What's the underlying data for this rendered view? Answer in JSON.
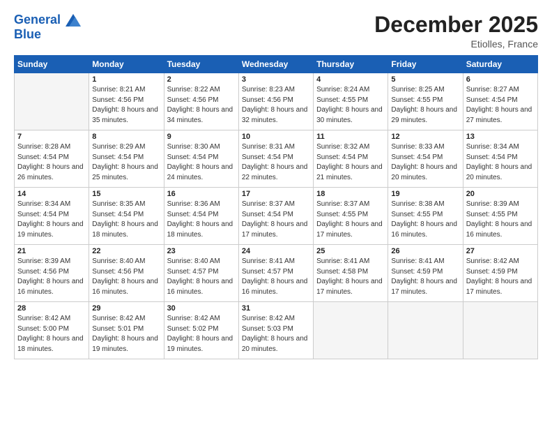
{
  "logo": {
    "line1": "General",
    "line2": "Blue"
  },
  "title": "December 2025",
  "location": "Etiolles, France",
  "days_of_week": [
    "Sunday",
    "Monday",
    "Tuesday",
    "Wednesday",
    "Thursday",
    "Friday",
    "Saturday"
  ],
  "weeks": [
    [
      {
        "num": "",
        "empty": true
      },
      {
        "num": "1",
        "sunrise": "8:21 AM",
        "sunset": "4:56 PM",
        "daylight": "8 hours and 35 minutes."
      },
      {
        "num": "2",
        "sunrise": "8:22 AM",
        "sunset": "4:56 PM",
        "daylight": "8 hours and 34 minutes."
      },
      {
        "num": "3",
        "sunrise": "8:23 AM",
        "sunset": "4:56 PM",
        "daylight": "8 hours and 32 minutes."
      },
      {
        "num": "4",
        "sunrise": "8:24 AM",
        "sunset": "4:55 PM",
        "daylight": "8 hours and 30 minutes."
      },
      {
        "num": "5",
        "sunrise": "8:25 AM",
        "sunset": "4:55 PM",
        "daylight": "8 hours and 29 minutes."
      },
      {
        "num": "6",
        "sunrise": "8:27 AM",
        "sunset": "4:54 PM",
        "daylight": "8 hours and 27 minutes."
      }
    ],
    [
      {
        "num": "7",
        "sunrise": "8:28 AM",
        "sunset": "4:54 PM",
        "daylight": "8 hours and 26 minutes."
      },
      {
        "num": "8",
        "sunrise": "8:29 AM",
        "sunset": "4:54 PM",
        "daylight": "8 hours and 25 minutes."
      },
      {
        "num": "9",
        "sunrise": "8:30 AM",
        "sunset": "4:54 PM",
        "daylight": "8 hours and 24 minutes."
      },
      {
        "num": "10",
        "sunrise": "8:31 AM",
        "sunset": "4:54 PM",
        "daylight": "8 hours and 22 minutes."
      },
      {
        "num": "11",
        "sunrise": "8:32 AM",
        "sunset": "4:54 PM",
        "daylight": "8 hours and 21 minutes."
      },
      {
        "num": "12",
        "sunrise": "8:33 AM",
        "sunset": "4:54 PM",
        "daylight": "8 hours and 20 minutes."
      },
      {
        "num": "13",
        "sunrise": "8:34 AM",
        "sunset": "4:54 PM",
        "daylight": "8 hours and 20 minutes."
      }
    ],
    [
      {
        "num": "14",
        "sunrise": "8:34 AM",
        "sunset": "4:54 PM",
        "daylight": "8 hours and 19 minutes."
      },
      {
        "num": "15",
        "sunrise": "8:35 AM",
        "sunset": "4:54 PM",
        "daylight": "8 hours and 18 minutes."
      },
      {
        "num": "16",
        "sunrise": "8:36 AM",
        "sunset": "4:54 PM",
        "daylight": "8 hours and 18 minutes."
      },
      {
        "num": "17",
        "sunrise": "8:37 AM",
        "sunset": "4:54 PM",
        "daylight": "8 hours and 17 minutes."
      },
      {
        "num": "18",
        "sunrise": "8:37 AM",
        "sunset": "4:55 PM",
        "daylight": "8 hours and 17 minutes."
      },
      {
        "num": "19",
        "sunrise": "8:38 AM",
        "sunset": "4:55 PM",
        "daylight": "8 hours and 16 minutes."
      },
      {
        "num": "20",
        "sunrise": "8:39 AM",
        "sunset": "4:55 PM",
        "daylight": "8 hours and 16 minutes."
      }
    ],
    [
      {
        "num": "21",
        "sunrise": "8:39 AM",
        "sunset": "4:56 PM",
        "daylight": "8 hours and 16 minutes."
      },
      {
        "num": "22",
        "sunrise": "8:40 AM",
        "sunset": "4:56 PM",
        "daylight": "8 hours and 16 minutes."
      },
      {
        "num": "23",
        "sunrise": "8:40 AM",
        "sunset": "4:57 PM",
        "daylight": "8 hours and 16 minutes."
      },
      {
        "num": "24",
        "sunrise": "8:41 AM",
        "sunset": "4:57 PM",
        "daylight": "8 hours and 16 minutes."
      },
      {
        "num": "25",
        "sunrise": "8:41 AM",
        "sunset": "4:58 PM",
        "daylight": "8 hours and 17 minutes."
      },
      {
        "num": "26",
        "sunrise": "8:41 AM",
        "sunset": "4:59 PM",
        "daylight": "8 hours and 17 minutes."
      },
      {
        "num": "27",
        "sunrise": "8:42 AM",
        "sunset": "4:59 PM",
        "daylight": "8 hours and 17 minutes."
      }
    ],
    [
      {
        "num": "28",
        "sunrise": "8:42 AM",
        "sunset": "5:00 PM",
        "daylight": "8 hours and 18 minutes."
      },
      {
        "num": "29",
        "sunrise": "8:42 AM",
        "sunset": "5:01 PM",
        "daylight": "8 hours and 19 minutes."
      },
      {
        "num": "30",
        "sunrise": "8:42 AM",
        "sunset": "5:02 PM",
        "daylight": "8 hours and 19 minutes."
      },
      {
        "num": "31",
        "sunrise": "8:42 AM",
        "sunset": "5:03 PM",
        "daylight": "8 hours and 20 minutes."
      },
      {
        "num": "",
        "empty": true
      },
      {
        "num": "",
        "empty": true
      },
      {
        "num": "",
        "empty": true
      }
    ]
  ]
}
